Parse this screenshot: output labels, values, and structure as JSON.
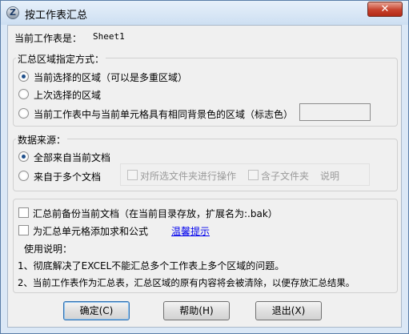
{
  "window": {
    "title": "按工作表汇总",
    "close_label": "✕"
  },
  "sheet": {
    "label": "当前工作表是：",
    "name": "Sheet1"
  },
  "region": {
    "legend": "汇总区域指定方式：",
    "options": [
      {
        "label": "当前选择的区域（可以是多重区域）",
        "checked": true
      },
      {
        "label": "上次选择的区域",
        "checked": false
      },
      {
        "label": "当前工作表中与当前单元格具有相同背景色的区域（标志色）",
        "checked": false
      }
    ]
  },
  "source": {
    "legend": "数据来源：",
    "options": [
      {
        "label": "全部来自当前文档",
        "checked": true
      },
      {
        "label": "来自于多个文档",
        "checked": false
      }
    ],
    "sub_options": {
      "selected_folder": "对所选文件夹进行操作",
      "include_subfolders": "含子文件夹",
      "help": "说明"
    }
  },
  "options": {
    "backup": "汇总前备份当前文档（在当前目录存放，扩展名为:.bak）",
    "add_formula": "为汇总单元格添加求和公式",
    "tip_link": "温馨提示",
    "usage_title": "使用说明：",
    "usage_1": "1、彻底解决了EXCEL不能汇总多个工作表上多个区域的问题。",
    "usage_2": "2、当前工作表作为汇总表，汇总区域的原有内容将会被清除，以便存放汇总结果。"
  },
  "buttons": {
    "ok": "确定(C)",
    "help": "帮助(H)",
    "exit": "退出(X)"
  }
}
